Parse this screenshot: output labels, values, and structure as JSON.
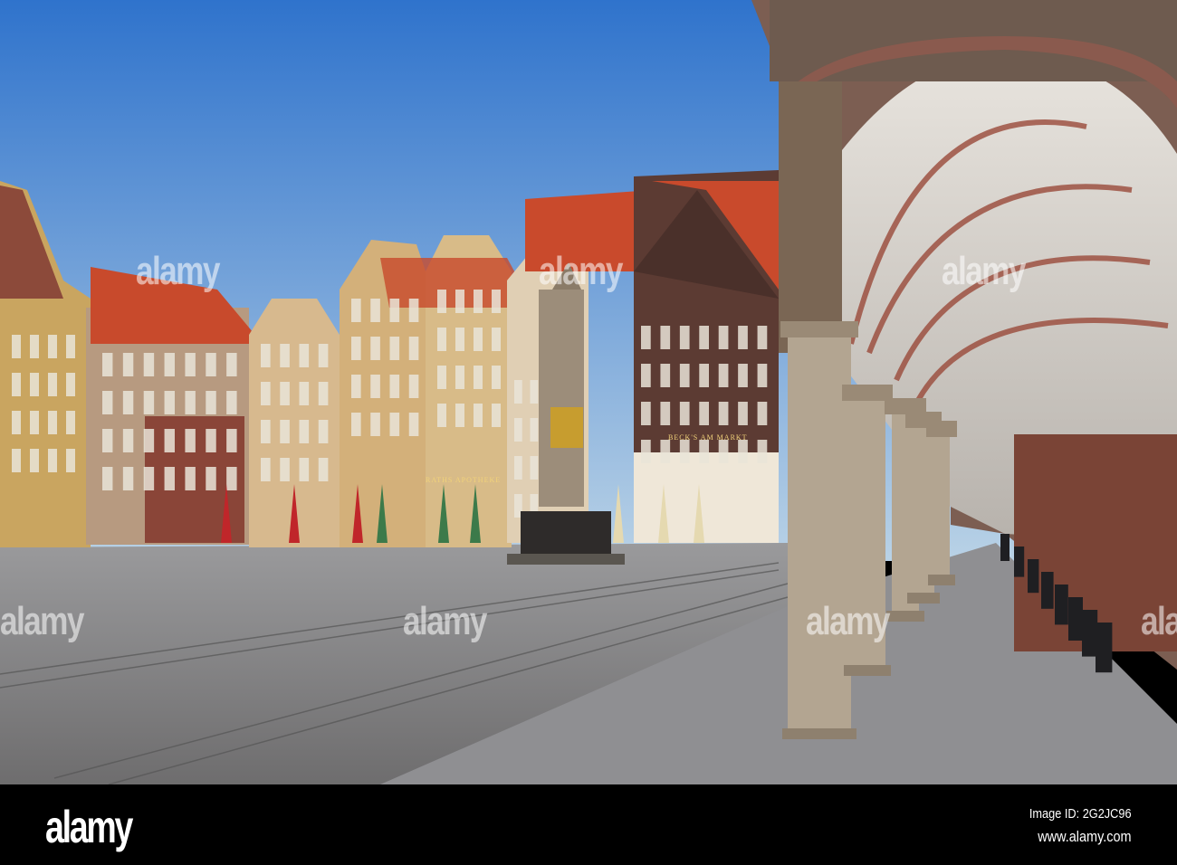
{
  "photo": {
    "subject": "Bremen market square with arcade",
    "signs": {
      "becks": "BECK'S AM MARKT",
      "apotheke": "RATHS APOTHEKE"
    },
    "colors": {
      "sky_top": "#2f73cc",
      "sky_bottom": "#b9d2e6",
      "roof": "#c9482a",
      "stone": "#b59a72",
      "pavement": "#8a8a8c"
    }
  },
  "watermarks": [
    "alamy",
    "alamy",
    "alamy",
    "alamy",
    "alamy",
    "alamy",
    "alamy"
  ],
  "footer": {
    "logo": "alamy",
    "image_id": "Image ID: 2G2JC96",
    "url": "www.alamy.com"
  }
}
